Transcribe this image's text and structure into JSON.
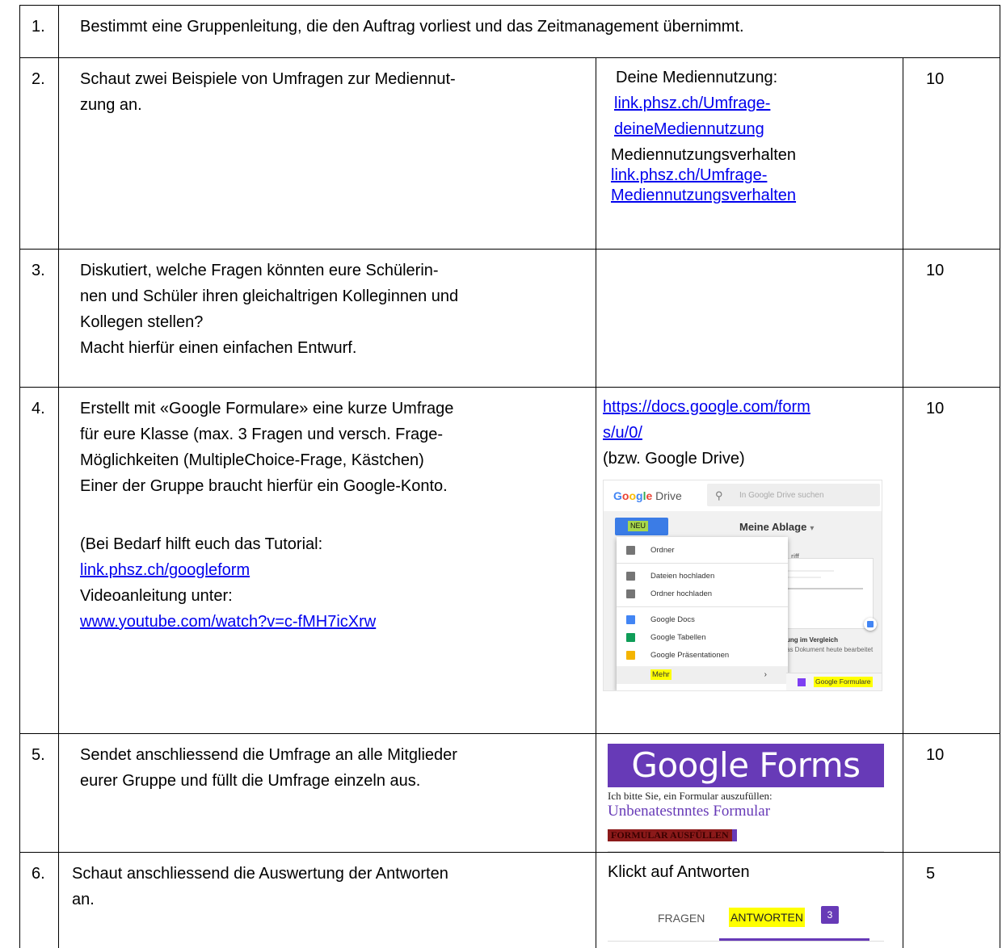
{
  "rows": [
    {
      "num": "1.",
      "desc": [
        "Bestimmt eine Gruppenleitung, die den Auftrag vorliest und das Zeitmanagement übernimmt."
      ]
    },
    {
      "num": "2.",
      "desc": [
        "Schaut zwei Beispiele von Umfragen zur Mediennut-",
        "zung an."
      ],
      "resources": {
        "label1": "Deine Mediennutzung:",
        "link1a": "link.phsz.ch/Umfrage-",
        "link1b": "deineMediennutzung",
        "label2": "Mediennutzungsverhalten",
        "link2a": "link.phsz.ch/Umfrage-",
        "link2b": "Mediennutzungsverhalten"
      },
      "time": "10"
    },
    {
      "num": "3.",
      "desc": [
        "Diskutiert, welche Fragen könnten eure Schülerin-",
        "nen und Schüler ihren gleichaltrigen Kolleginnen und",
        "Kollegen stellen?",
        "Macht hierfür einen einfachen Entwurf."
      ],
      "time": "10"
    },
    {
      "num": "4.",
      "desc": [
        "Erstellt mit «Google Formulare» eine kurze Umfrage",
        "für eure Klasse (max. 3 Fragen und versch. Frage-",
        "Möglichkeiten (MultipleChoice-Frage, Kästchen)",
        "Einer der Gruppe braucht hierfür ein Google-Konto."
      ],
      "tutorial": {
        "intro": "(Bei Bedarf hilft euch das Tutorial:",
        "link": "link.phsz.ch/googleform",
        "video_label": "Videoanleitung unter:",
        "video_link": "www.youtube.com/watch?v=c-fMH7icXrw"
      },
      "resources": {
        "link_a": "https://docs.google.com/form",
        "link_b": "s/u/0/",
        "note": "(bzw. Google Drive)"
      },
      "time": "10"
    },
    {
      "num": "5.",
      "desc": [
        "Sendet anschliessend die Umfrage an alle Mitglieder",
        "eurer Gruppe und füllt die Umfrage einzeln aus."
      ],
      "time": "10"
    },
    {
      "num": "6.",
      "desc": [
        "Schaut anschliessend die Auswertung der Antworten",
        "an."
      ],
      "resources": {
        "label": "Klickt auf Antworten"
      },
      "time": "5"
    }
  ],
  "drive": {
    "brand_google": "Google",
    "brand_drive": "Drive",
    "search_placeholder": "In Google Drive suchen",
    "new_button": "NEU",
    "my_drive": "Meine Ablage",
    "menu": [
      "Ordner",
      "Dateien hochladen",
      "Ordner hochladen",
      "Google Docs",
      "Google Tabellen",
      "Google Präsentationen",
      "Mehr"
    ],
    "partial_griff": "riff",
    "partial_compare": "ung im Vergleich",
    "partial_today": "as Dokument heute bearbeitet",
    "submenu_forms": "Google Formulare",
    "icon_colors": {
      "folder": "#757575",
      "docs": "#4285f4",
      "sheets": "#0f9d58",
      "slides": "#f4b400",
      "forms": "#7e3ff2"
    }
  },
  "forms": {
    "banner": "Google Forms",
    "ask": "Ich bitte Sie, ein Formular auszufüllen:",
    "title": "Unbenatestnntes Formular",
    "fill_button": "FORMULAR AUSFÜLLEN",
    "brand_color": "#673ab7"
  },
  "tabs": {
    "questions": "FRAGEN",
    "answers": "ANTWORTEN",
    "count": "3"
  }
}
